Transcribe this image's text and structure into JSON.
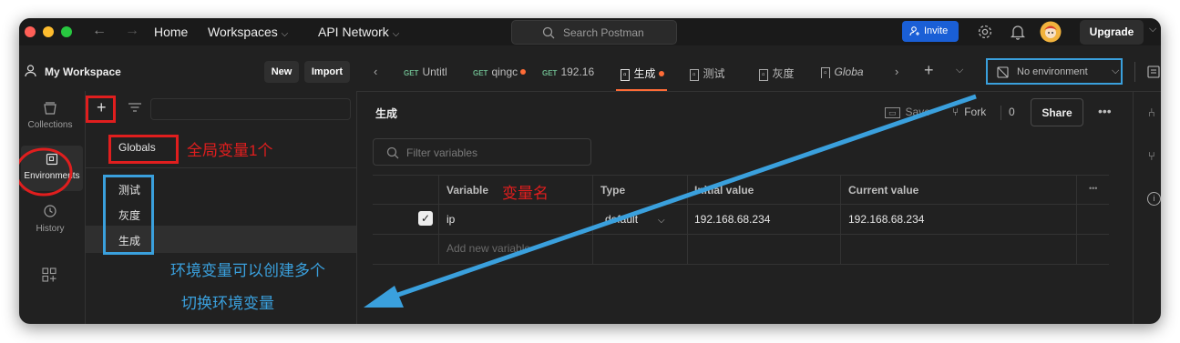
{
  "header": {
    "home": "Home",
    "workspaces": "Workspaces",
    "api_network": "API Network",
    "search_placeholder": "Search Postman",
    "invite": "Invite",
    "upgrade": "Upgrade"
  },
  "workspace": {
    "name": "My Workspace",
    "new": "New",
    "import": "Import"
  },
  "rail": {
    "collections": "Collections",
    "environments": "Environments",
    "history": "History"
  },
  "environments": {
    "globals": "Globals",
    "items": [
      "测试",
      "灰度",
      "生成"
    ]
  },
  "tabs": [
    {
      "method": "GET",
      "name": "Untitl",
      "dirty": false
    },
    {
      "method": "GET",
      "name": "qingc",
      "dirty": true
    },
    {
      "method": "GET",
      "name": "192.16",
      "dirty": false
    },
    {
      "method": "",
      "name": "生成",
      "dirty": true,
      "active": true
    },
    {
      "method": "",
      "name": "测试",
      "dirty": false
    },
    {
      "method": "",
      "name": "灰度",
      "dirty": false
    },
    {
      "method": "",
      "name": "Globa",
      "dirty": false
    }
  ],
  "env_selector": "No environment",
  "main": {
    "title": "生成",
    "save": "Save",
    "fork": "Fork",
    "fork_count": "0",
    "share": "Share",
    "filter_placeholder": "Filter variables",
    "columns": [
      "Variable",
      "Type",
      "Initial value",
      "Current value"
    ],
    "rows": [
      {
        "variable": "ip",
        "type": "default",
        "initial": "192.168.68.234",
        "current": "192.168.68.234",
        "enabled": true
      }
    ],
    "add_placeholder": "Add new variable"
  },
  "annotations": {
    "globals_note": "全局变量1个",
    "variable_note": "变量名",
    "env_note_1": "环境变量可以创建多个",
    "env_note_2": "切换环境变量"
  },
  "colors": {
    "annotation_red": "#e01e1e",
    "annotation_blue": "#3aa0dd",
    "invite_blue": "#1a5fd6",
    "tab_dot": "#ff6c37",
    "method_green": "#6bb38a"
  }
}
